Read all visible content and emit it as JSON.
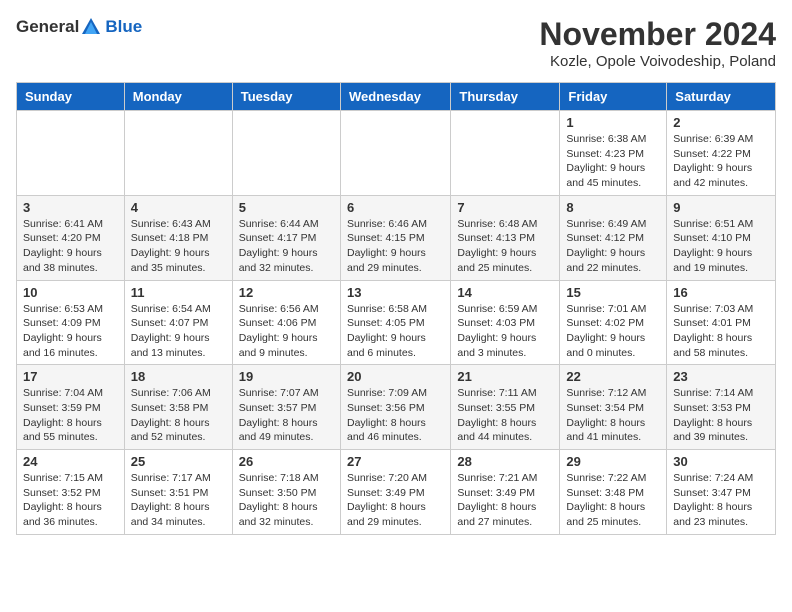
{
  "header": {
    "logo_general": "General",
    "logo_blue": "Blue",
    "month_title": "November 2024",
    "location": "Kozle, Opole Voivodeship, Poland"
  },
  "weekdays": [
    "Sunday",
    "Monday",
    "Tuesday",
    "Wednesday",
    "Thursday",
    "Friday",
    "Saturday"
  ],
  "weeks": [
    [
      {
        "day": "",
        "info": ""
      },
      {
        "day": "",
        "info": ""
      },
      {
        "day": "",
        "info": ""
      },
      {
        "day": "",
        "info": ""
      },
      {
        "day": "",
        "info": ""
      },
      {
        "day": "1",
        "info": "Sunrise: 6:38 AM\nSunset: 4:23 PM\nDaylight: 9 hours and 45 minutes."
      },
      {
        "day": "2",
        "info": "Sunrise: 6:39 AM\nSunset: 4:22 PM\nDaylight: 9 hours and 42 minutes."
      }
    ],
    [
      {
        "day": "3",
        "info": "Sunrise: 6:41 AM\nSunset: 4:20 PM\nDaylight: 9 hours and 38 minutes."
      },
      {
        "day": "4",
        "info": "Sunrise: 6:43 AM\nSunset: 4:18 PM\nDaylight: 9 hours and 35 minutes."
      },
      {
        "day": "5",
        "info": "Sunrise: 6:44 AM\nSunset: 4:17 PM\nDaylight: 9 hours and 32 minutes."
      },
      {
        "day": "6",
        "info": "Sunrise: 6:46 AM\nSunset: 4:15 PM\nDaylight: 9 hours and 29 minutes."
      },
      {
        "day": "7",
        "info": "Sunrise: 6:48 AM\nSunset: 4:13 PM\nDaylight: 9 hours and 25 minutes."
      },
      {
        "day": "8",
        "info": "Sunrise: 6:49 AM\nSunset: 4:12 PM\nDaylight: 9 hours and 22 minutes."
      },
      {
        "day": "9",
        "info": "Sunrise: 6:51 AM\nSunset: 4:10 PM\nDaylight: 9 hours and 19 minutes."
      }
    ],
    [
      {
        "day": "10",
        "info": "Sunrise: 6:53 AM\nSunset: 4:09 PM\nDaylight: 9 hours and 16 minutes."
      },
      {
        "day": "11",
        "info": "Sunrise: 6:54 AM\nSunset: 4:07 PM\nDaylight: 9 hours and 13 minutes."
      },
      {
        "day": "12",
        "info": "Sunrise: 6:56 AM\nSunset: 4:06 PM\nDaylight: 9 hours and 9 minutes."
      },
      {
        "day": "13",
        "info": "Sunrise: 6:58 AM\nSunset: 4:05 PM\nDaylight: 9 hours and 6 minutes."
      },
      {
        "day": "14",
        "info": "Sunrise: 6:59 AM\nSunset: 4:03 PM\nDaylight: 9 hours and 3 minutes."
      },
      {
        "day": "15",
        "info": "Sunrise: 7:01 AM\nSunset: 4:02 PM\nDaylight: 9 hours and 0 minutes."
      },
      {
        "day": "16",
        "info": "Sunrise: 7:03 AM\nSunset: 4:01 PM\nDaylight: 8 hours and 58 minutes."
      }
    ],
    [
      {
        "day": "17",
        "info": "Sunrise: 7:04 AM\nSunset: 3:59 PM\nDaylight: 8 hours and 55 minutes."
      },
      {
        "day": "18",
        "info": "Sunrise: 7:06 AM\nSunset: 3:58 PM\nDaylight: 8 hours and 52 minutes."
      },
      {
        "day": "19",
        "info": "Sunrise: 7:07 AM\nSunset: 3:57 PM\nDaylight: 8 hours and 49 minutes."
      },
      {
        "day": "20",
        "info": "Sunrise: 7:09 AM\nSunset: 3:56 PM\nDaylight: 8 hours and 46 minutes."
      },
      {
        "day": "21",
        "info": "Sunrise: 7:11 AM\nSunset: 3:55 PM\nDaylight: 8 hours and 44 minutes."
      },
      {
        "day": "22",
        "info": "Sunrise: 7:12 AM\nSunset: 3:54 PM\nDaylight: 8 hours and 41 minutes."
      },
      {
        "day": "23",
        "info": "Sunrise: 7:14 AM\nSunset: 3:53 PM\nDaylight: 8 hours and 39 minutes."
      }
    ],
    [
      {
        "day": "24",
        "info": "Sunrise: 7:15 AM\nSunset: 3:52 PM\nDaylight: 8 hours and 36 minutes."
      },
      {
        "day": "25",
        "info": "Sunrise: 7:17 AM\nSunset: 3:51 PM\nDaylight: 8 hours and 34 minutes."
      },
      {
        "day": "26",
        "info": "Sunrise: 7:18 AM\nSunset: 3:50 PM\nDaylight: 8 hours and 32 minutes."
      },
      {
        "day": "27",
        "info": "Sunrise: 7:20 AM\nSunset: 3:49 PM\nDaylight: 8 hours and 29 minutes."
      },
      {
        "day": "28",
        "info": "Sunrise: 7:21 AM\nSunset: 3:49 PM\nDaylight: 8 hours and 27 minutes."
      },
      {
        "day": "29",
        "info": "Sunrise: 7:22 AM\nSunset: 3:48 PM\nDaylight: 8 hours and 25 minutes."
      },
      {
        "day": "30",
        "info": "Sunrise: 7:24 AM\nSunset: 3:47 PM\nDaylight: 8 hours and 23 minutes."
      }
    ]
  ]
}
